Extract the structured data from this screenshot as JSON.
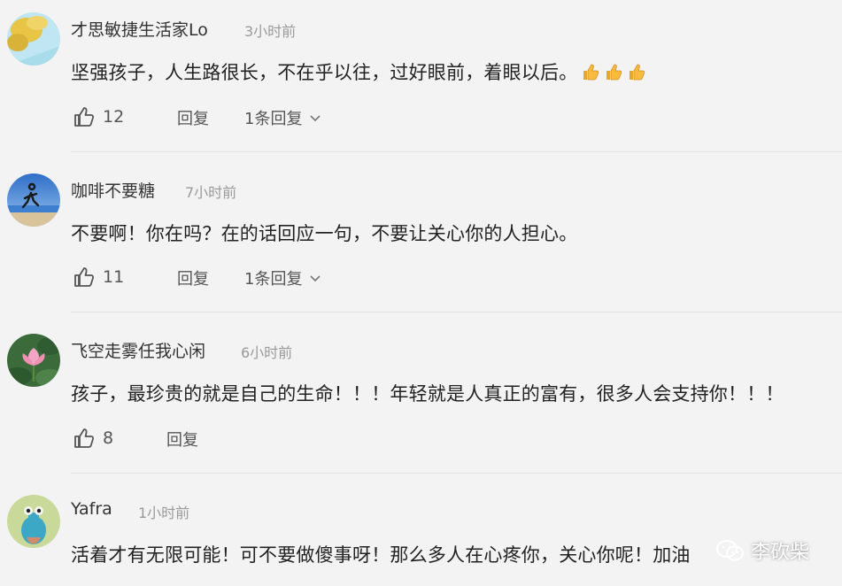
{
  "comments": [
    {
      "author": "才思敏捷生活家Lo",
      "time": "3小时前",
      "text": "坚强孩子，人生路很长，不在乎以往，过好眼前，着眼以后。",
      "likes": "12",
      "reply_label": "回复",
      "replies_label": "1条回复"
    },
    {
      "author": "咖啡不要糖",
      "time": "7小时前",
      "text": "不要啊！你在吗？在的话回应一句，不要让关心你的人担心。",
      "likes": "11",
      "reply_label": "回复",
      "replies_label": "1条回复"
    },
    {
      "author": "飞空走雾任我心闲",
      "time": "6小时前",
      "text": "孩子，最珍贵的就是自己的生命！！！年轻就是人真正的富有，很多人会支持你！！！",
      "likes": "8",
      "reply_label": "回复"
    },
    {
      "author": "Yafra",
      "time": "1小时前",
      "text": "活着才有无限可能！可不要做傻事呀！那么多人在心疼你，关心你呢！加油"
    }
  ],
  "watermark": {
    "text": "李砍柴"
  },
  "icons": {
    "like": "thumbs-up-icon",
    "expand": "chevron-down-icon",
    "emoji": "thumbs-up-emoji-icon",
    "watermark": "wechat-icon"
  }
}
